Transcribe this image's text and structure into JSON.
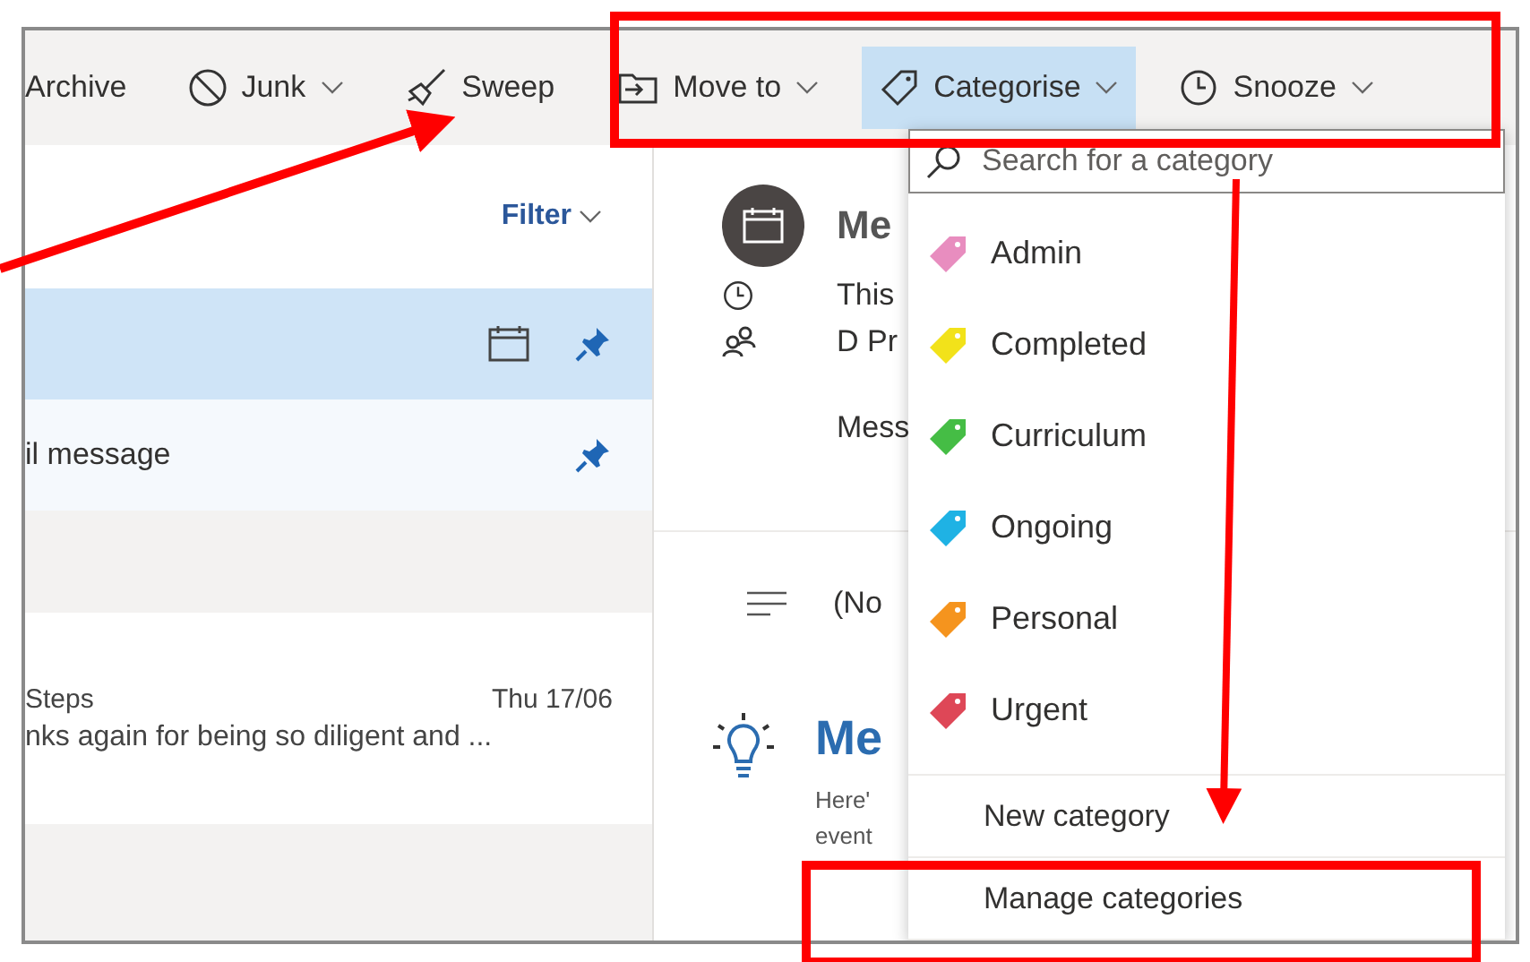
{
  "toolbar": [
    {
      "label": "Archive",
      "has_menu": false,
      "selected": false
    },
    {
      "label": "Junk",
      "has_menu": true,
      "selected": false
    },
    {
      "label": "Sweep",
      "has_menu": false,
      "selected": false
    },
    {
      "label": "Move to",
      "has_menu": true,
      "selected": false
    },
    {
      "label": "Categorise",
      "has_menu": true,
      "selected": true
    },
    {
      "label": "Snooze",
      "has_menu": true,
      "selected": false
    }
  ],
  "message_list": {
    "filter": "Filter",
    "rows": [
      {
        "kind": "message",
        "selected": true,
        "pinned": true,
        "has_event": true
      },
      {
        "kind": "message",
        "selected": false,
        "pinned": true,
        "subject": "il message"
      },
      {
        "kind": "group"
      },
      {
        "kind": "message",
        "selected": false,
        "pinned": false,
        "sender": "Steps",
        "date": "Thu 17/06",
        "preview": "nks again for being so diligent and ..."
      }
    ]
  },
  "reading_pane": {
    "title": "Me",
    "time": "This",
    "people": "D Pr",
    "message": "Mess",
    "body": "(No",
    "tip_title": "Me",
    "tip_lines": [
      "Here'",
      "event"
    ]
  },
  "category_menu": {
    "search_placeholder": "Search for a category",
    "categories": [
      {
        "name": "Admin",
        "color": "#e88dbf"
      },
      {
        "name": "Completed",
        "color": "#f2e21a"
      },
      {
        "name": "Curriculum",
        "color": "#45bd45"
      },
      {
        "name": "Ongoing",
        "color": "#1fb2e4"
      },
      {
        "name": "Personal",
        "color": "#f5941e"
      },
      {
        "name": "Urgent",
        "color": "#de4757"
      }
    ],
    "actions": [
      "New category",
      "Manage categories"
    ]
  }
}
